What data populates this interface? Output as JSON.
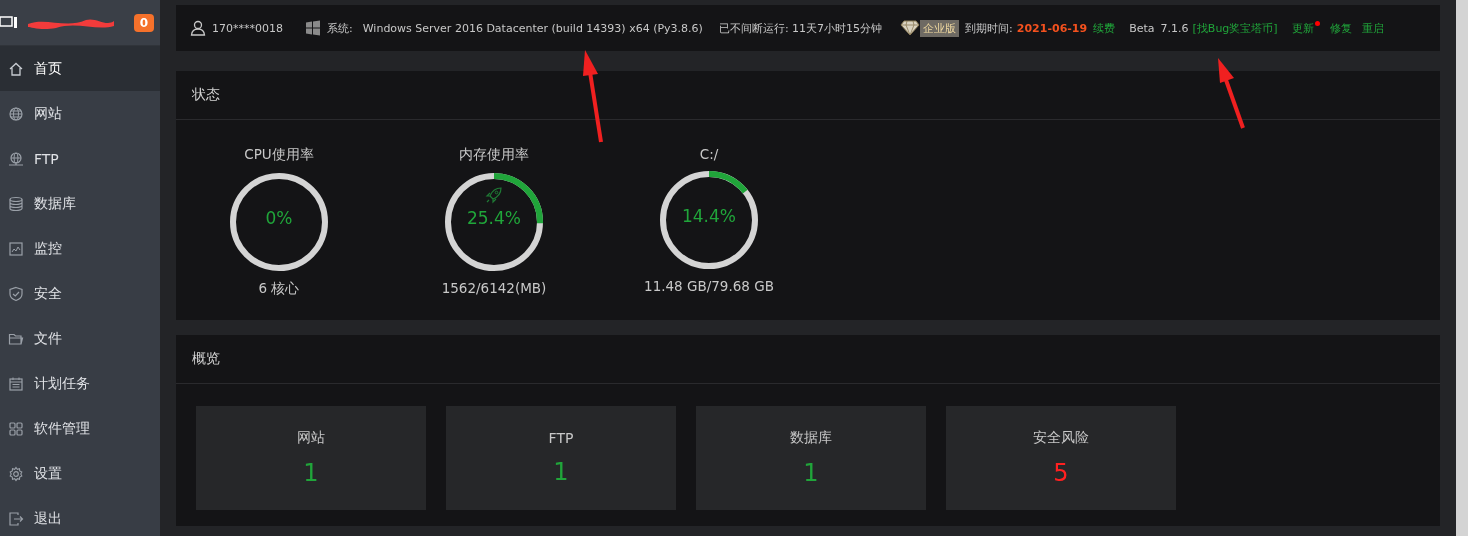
{
  "sidebar": {
    "notification_count": "0",
    "items": [
      {
        "label": "首页",
        "selected": true
      },
      {
        "label": "网站",
        "selected": false
      },
      {
        "label": "FTP",
        "selected": false
      },
      {
        "label": "数据库",
        "selected": false
      },
      {
        "label": "监控",
        "selected": false
      },
      {
        "label": "安全",
        "selected": false
      },
      {
        "label": "文件",
        "selected": false
      },
      {
        "label": "计划任务",
        "selected": false
      },
      {
        "label": "软件管理",
        "selected": false
      },
      {
        "label": "设置",
        "selected": false
      },
      {
        "label": "退出",
        "selected": false
      }
    ]
  },
  "topbar": {
    "user": "170****0018",
    "system_label": "系统:",
    "system": "Windows Server 2016 Datacenter (build 14393) x64 (Py3.8.6)",
    "uptime": "已不间断运行: 11天7小时15分钟",
    "edition": "企业版",
    "expiry_label": "到期时间:",
    "expiry_date": "2021-06-19",
    "renew": "续费",
    "channel": "Beta",
    "version": "7.1.6",
    "bug_link": "[找Bug奖宝塔币]",
    "actions": [
      {
        "label": "更新",
        "has_dot": true
      },
      {
        "label": "修复",
        "has_dot": false
      },
      {
        "label": "重启",
        "has_dot": false
      }
    ]
  },
  "status": {
    "title": "状态",
    "gauges": [
      {
        "title": "CPU使用率",
        "value": "0%",
        "level": 0,
        "detail": "6 核心",
        "boost_icon": false
      },
      {
        "title": "内存使用率",
        "value": "25.4%",
        "level": 0.254,
        "detail": "1562/6142(MB)",
        "boost_icon": true
      },
      {
        "title": "C:/",
        "value": "14.4%",
        "level": 0.144,
        "detail": "11.48 GB/79.68 GB",
        "boost_icon": false
      }
    ]
  },
  "overview": {
    "title": "概览",
    "cards": [
      {
        "label": "网站",
        "count": "1",
        "kind": "normal"
      },
      {
        "label": "FTP",
        "count": "1",
        "kind": "normal"
      },
      {
        "label": "数据库",
        "count": "1",
        "kind": "normal"
      },
      {
        "label": "安全风险",
        "count": "5",
        "kind": "risk"
      }
    ]
  }
}
